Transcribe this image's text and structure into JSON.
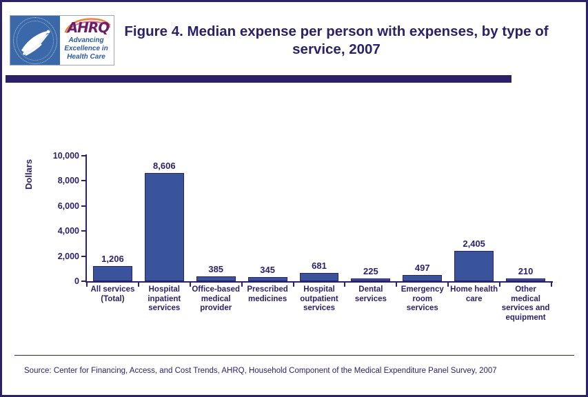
{
  "header": {
    "title": "Figure 4. Median expense per person with expenses, by type of service, 2007",
    "logo": {
      "seal_name": "hhs-seal",
      "wordmark": "AHRQ",
      "tagline_line1": "Advancing",
      "tagline_line2": "Excellence in",
      "tagline_line3": "Health Care"
    }
  },
  "footer": {
    "source": "Source: Center for Financing, Access, and Cost Trends, AHRQ, Household Component of the Medical Expenditure Panel Survey,  2007"
  },
  "colors": {
    "navy": "#2b2168",
    "bar_fill": "#3a549c",
    "bar_border": "#2b2168",
    "seal_blue": "#3a68a8",
    "ahrq_purple": "#6b1f6b",
    "ahrq_tagline_blue": "#2c5aa0"
  },
  "chart_data": {
    "type": "bar",
    "title": "Figure 4. Median expense per person with expenses, by type of service, 2007",
    "xlabel": "",
    "ylabel": "Dollars",
    "ylim": [
      0,
      10000
    ],
    "yticks": [
      0,
      2000,
      4000,
      6000,
      8000,
      10000
    ],
    "ytick_labels": [
      "0",
      "2,000",
      "4,000",
      "6,000",
      "8,000",
      "10,000"
    ],
    "grid": false,
    "legend": "none",
    "categories": [
      "All services (Total)",
      "Hospital inpatient services",
      "Office-based medical provider",
      "Prescribed medicines",
      "Hospital outpatient services",
      "Dental services",
      "Emergency room services",
      "Home health care",
      "Other medical services and equipment"
    ],
    "category_label_lines": [
      [
        "All services",
        "(Total)"
      ],
      [
        "Hospital",
        "inpatient",
        "services"
      ],
      [
        "Office-based",
        "medical",
        "provider"
      ],
      [
        "Prescribed",
        "medicines"
      ],
      [
        "Hospital",
        "outpatient",
        "services"
      ],
      [
        "Dental",
        "services"
      ],
      [
        "Emergency",
        "room",
        "services"
      ],
      [
        "Home health",
        "care"
      ],
      [
        "Other",
        "medical",
        "services and",
        "equipment"
      ]
    ],
    "values": [
      1206,
      8606,
      385,
      345,
      681,
      225,
      497,
      2405,
      210
    ],
    "data_labels": [
      "1,206",
      "8,606",
      "385",
      "345",
      "681",
      "225",
      "497",
      "2,405",
      "210"
    ]
  }
}
